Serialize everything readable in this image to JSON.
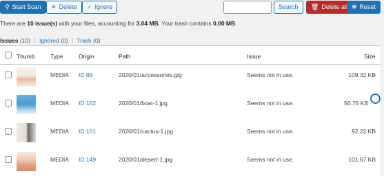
{
  "toolbar": {
    "start_scan": "Start Scan",
    "delete": "Delete",
    "ignore": "Ignore",
    "search_value": "",
    "search_button": "Search",
    "delete_all": "Delete all",
    "reset": "Reset"
  },
  "summary": {
    "prefix": "There are ",
    "issues_count": "10 issue(s)",
    "middle": " with your files, accounting for ",
    "size": "3.04 MB",
    "trash_text": ". Your trash contains ",
    "trash_size": "0.00 MB",
    "suffix": "."
  },
  "views": {
    "issues": "Issues",
    "issues_count": "(10)",
    "ignored": "Ignored",
    "ignored_count": "(0)",
    "trash": "Trash",
    "trash_count": "(0)",
    "separator": "|"
  },
  "table": {
    "headers": {
      "thumb": "Thumb",
      "type": "Type",
      "origin": "Origin",
      "path": "Path",
      "issue": "Issue",
      "size": "Size"
    },
    "rows": [
      {
        "type": "MEDIA",
        "origin": "ID 89",
        "path": "2020/01/accessories.jpg",
        "issue": "Seems not in use.",
        "size": "109.32 KB"
      },
      {
        "type": "MEDIA",
        "origin": "ID 152",
        "path": "2020/01/boat-1.jpg",
        "issue": "Seems not in use.",
        "size": "56.76 KB"
      },
      {
        "type": "MEDIA",
        "origin": "ID 151",
        "path": "2020/01/cactus-1.jpg",
        "issue": "Seems not in use.",
        "size": "92.22 KB"
      },
      {
        "type": "MEDIA",
        "origin": "ID 149",
        "path": "2020/01/desert-1.jpg",
        "issue": "Seems not in use.",
        "size": "101.67 KB"
      }
    ]
  },
  "colors": {
    "primary": "#2271b1",
    "danger": "#b32d2e",
    "background": "#f1f1f1"
  },
  "icons": {
    "start_scan": "search-icon",
    "delete": "close-icon",
    "ignore": "check-icon",
    "delete_all": "trash-icon",
    "reset": "reset-icon"
  }
}
